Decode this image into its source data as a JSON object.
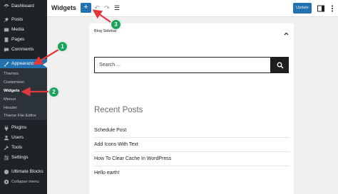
{
  "sidebar": {
    "items": [
      {
        "label": "Dashboard",
        "icon": "dashboard-icon"
      },
      {
        "label": "Posts",
        "icon": "pin-icon"
      },
      {
        "label": "Media",
        "icon": "media-icon"
      },
      {
        "label": "Pages",
        "icon": "pages-icon"
      },
      {
        "label": "Comments",
        "icon": "comments-icon"
      },
      {
        "label": "Appearance",
        "icon": "brush-icon"
      },
      {
        "label": "Plugins",
        "icon": "plugins-icon"
      },
      {
        "label": "Users",
        "icon": "users-icon"
      },
      {
        "label": "Tools",
        "icon": "tools-icon"
      },
      {
        "label": "Settings",
        "icon": "settings-icon"
      },
      {
        "label": "Ultimate Blocks",
        "icon": "blocks-icon"
      },
      {
        "label": "Collapse menu",
        "icon": "collapse-icon"
      }
    ],
    "submenu": [
      "Themes",
      "Customizer",
      "Widgets",
      "Menus",
      "Header",
      "Theme File Editor"
    ]
  },
  "topbar": {
    "title": "Widgets",
    "add_label": "+",
    "undo_icon": "↶",
    "redo_icon": "↷",
    "list_icon": "☰",
    "update_label": "Update"
  },
  "widget_area": {
    "title": "Blog Sidebar",
    "search_placeholder": "Search ...",
    "recent_heading": "Recent Posts",
    "posts": [
      "Schedule Post",
      "Add Icons With Text",
      "How To Clear Cache In WordPress",
      "Hello earth!"
    ]
  },
  "annotations": {
    "step1": "1",
    "step2": "2",
    "step3": "3"
  },
  "colors": {
    "sidebar": "#1d2327",
    "accent": "#2271b1",
    "arrow": "#e2383b",
    "badge": "#17a35a"
  }
}
